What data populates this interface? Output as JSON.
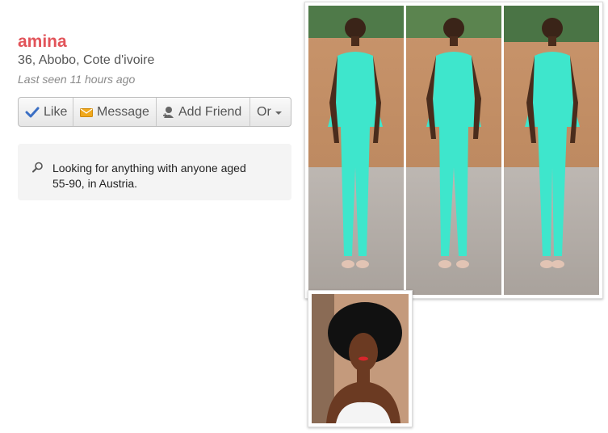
{
  "profile": {
    "name": "amina",
    "location": "36, Abobo, Cote d'ivoire",
    "last_seen": "Last seen 11 hours ago"
  },
  "actions": {
    "like": "Like",
    "message": "Message",
    "add_friend": "Add Friend",
    "or": "Or"
  },
  "looking_for": "Looking for anything with anyone aged 55-90, in Austria.",
  "colors": {
    "name": "#e2545a",
    "like_icon": "#3b6fc4",
    "message_icon": "#f0a81c",
    "outfit": "#3ee6cc"
  },
  "icons": [
    "checkmark-icon",
    "envelope-icon",
    "add-person-icon",
    "search-icon"
  ]
}
